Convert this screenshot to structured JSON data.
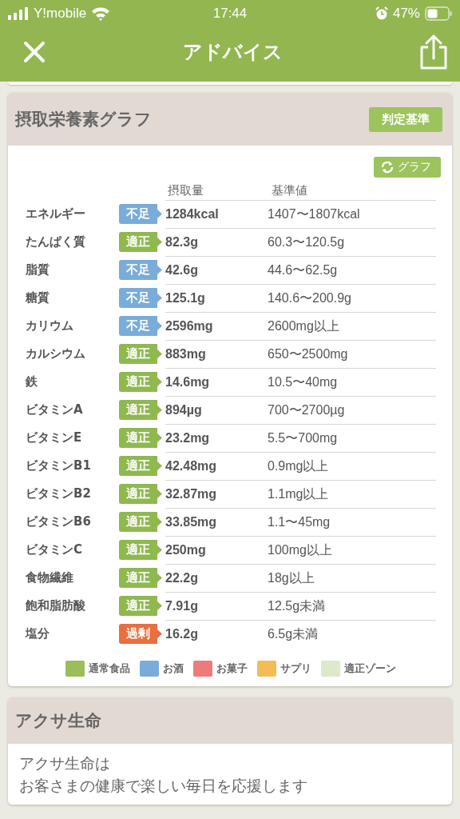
{
  "status_bar": {
    "carrier": "Y!mobile",
    "time": "17:44",
    "battery": "47%"
  },
  "nav": {
    "title": "アドバイス"
  },
  "nutrient_card": {
    "title": "摂取栄養素グラフ",
    "criteria_button": "判定基準",
    "graph_button": "グラフ",
    "columns": [
      "摂取量",
      "基準値"
    ],
    "rows": [
      {
        "name": "エネルギー",
        "status": "不足",
        "kind": "low",
        "intake": "1284kcal",
        "reference": "1407〜1807kcal"
      },
      {
        "name": "たんぱく質",
        "status": "適正",
        "kind": "ok",
        "intake": "82.3g",
        "reference": "60.3〜120.5g"
      },
      {
        "name": "脂質",
        "status": "不足",
        "kind": "low",
        "intake": "42.6g",
        "reference": "44.6〜62.5g"
      },
      {
        "name": "糖質",
        "status": "不足",
        "kind": "low",
        "intake": "125.1g",
        "reference": "140.6〜200.9g"
      },
      {
        "name": "カリウム",
        "status": "不足",
        "kind": "low",
        "intake": "2596mg",
        "reference": "2600mg以上"
      },
      {
        "name": "カルシウム",
        "status": "適正",
        "kind": "ok",
        "intake": "883mg",
        "reference": "650〜2500mg"
      },
      {
        "name": "鉄",
        "status": "適正",
        "kind": "ok",
        "intake": "14.6mg",
        "reference": "10.5〜40mg"
      },
      {
        "name": "ビタミンA",
        "status": "適正",
        "kind": "ok",
        "intake": "894µg",
        "reference": "700〜2700µg"
      },
      {
        "name": "ビタミンE",
        "status": "適正",
        "kind": "ok",
        "intake": "23.2mg",
        "reference": "5.5〜700mg"
      },
      {
        "name": "ビタミンB1",
        "status": "適正",
        "kind": "ok",
        "intake": "42.48mg",
        "reference": "0.9mg以上"
      },
      {
        "name": "ビタミンB2",
        "status": "適正",
        "kind": "ok",
        "intake": "32.87mg",
        "reference": "1.1mg以上"
      },
      {
        "name": "ビタミンB6",
        "status": "適正",
        "kind": "ok",
        "intake": "33.85mg",
        "reference": "1.1〜45mg"
      },
      {
        "name": "ビタミンC",
        "status": "適正",
        "kind": "ok",
        "intake": "250mg",
        "reference": "100mg以上"
      },
      {
        "name": "食物繊維",
        "status": "適正",
        "kind": "ok",
        "intake": "22.2g",
        "reference": "18g以上"
      },
      {
        "name": "飽和脂肪酸",
        "status": "適正",
        "kind": "ok",
        "intake": "7.91g",
        "reference": "12.5g未満"
      },
      {
        "name": "塩分",
        "status": "過剰",
        "kind": "over",
        "intake": "16.2g",
        "reference": "6.5g未満"
      }
    ],
    "legend": [
      {
        "label": "通常食品",
        "color": "#9bbd5a"
      },
      {
        "label": "お酒",
        "color": "#79acd9"
      },
      {
        "label": "お菓子",
        "color": "#ee7b7b"
      },
      {
        "label": "サプリ",
        "color": "#f2bd55"
      },
      {
        "label": "適正ゾーン",
        "color": "#dde9c9"
      }
    ]
  },
  "company_card": {
    "title": "アクサ生命",
    "lines": [
      "アクサ生命は",
      "お客さまの健康で楽しい毎日を応援します"
    ]
  }
}
